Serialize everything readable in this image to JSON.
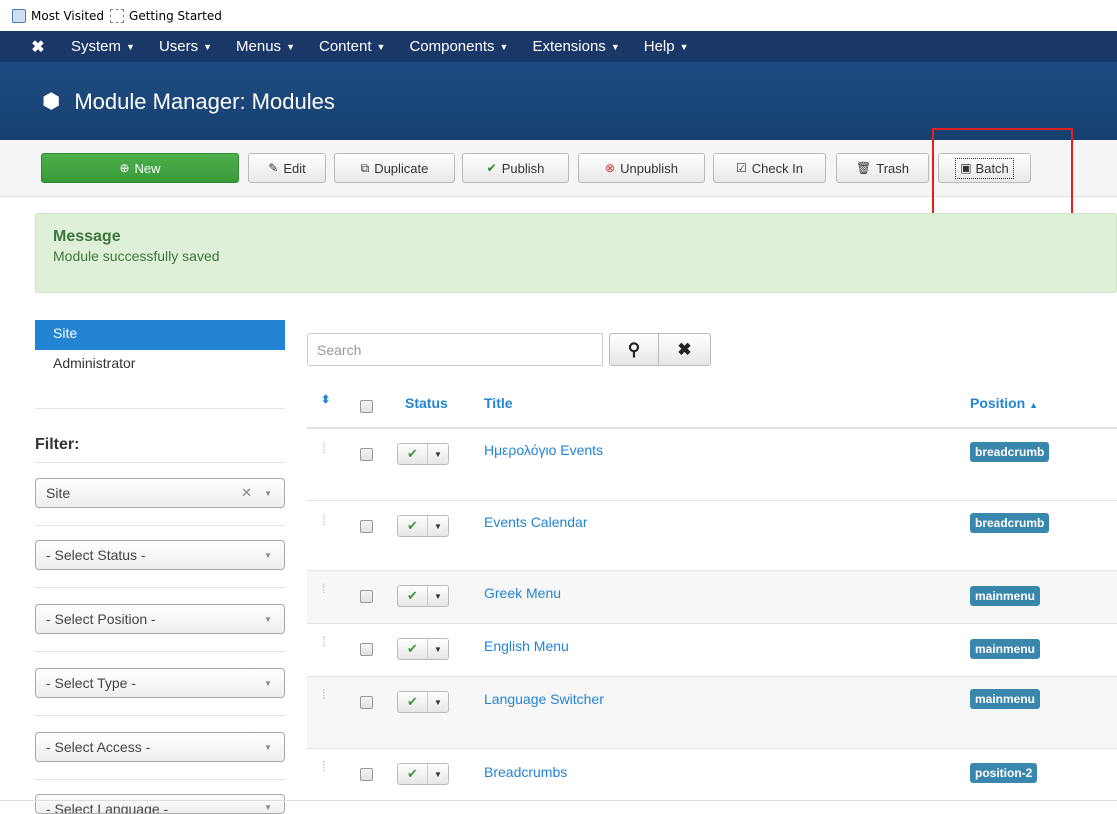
{
  "bookmarks": [
    {
      "label": "Most Visited",
      "icon": "bookmark-folder-icon"
    },
    {
      "label": "Getting Started",
      "icon": "page-icon"
    }
  ],
  "navbar": {
    "logo_icon": "joomla-logo-icon",
    "items": [
      "System",
      "Users",
      "Menus",
      "Content",
      "Components",
      "Extensions",
      "Help"
    ]
  },
  "page": {
    "title": "Module Manager: Modules",
    "title_icon": "cube-icon"
  },
  "toolbar": {
    "new": "New",
    "edit": "Edit",
    "duplicate": "Duplicate",
    "publish": "Publish",
    "unpublish": "Unpublish",
    "checkin": "Check In",
    "trash": "Trash",
    "batch": "Batch"
  },
  "message": {
    "heading": "Message",
    "text": "Module successfully saved"
  },
  "sidebar": {
    "links": [
      "Site",
      "Administrator"
    ],
    "filter_title": "Filter:",
    "filters": [
      "Site",
      "- Select Status -",
      "- Select Position -",
      "- Select Type -",
      "- Select Access -",
      "- Select Language -"
    ]
  },
  "search": {
    "placeholder": "Search"
  },
  "table": {
    "headers": {
      "status": "Status",
      "title": "Title",
      "position": "Position"
    },
    "rows": [
      {
        "title": "Ημερολόγιο Events",
        "position": "breadcrumb"
      },
      {
        "title": "Events Calendar",
        "position": "breadcrumb"
      },
      {
        "title": "Greek Menu",
        "position": "mainmenu"
      },
      {
        "title": "English Menu",
        "position": "mainmenu"
      },
      {
        "title": "Language Switcher",
        "position": "mainmenu"
      },
      {
        "title": "Breadcrumbs",
        "position": "position-2"
      }
    ]
  },
  "colors": {
    "navbar": "#1a3867",
    "titlebar": "#1e4c82",
    "accent": "#2384d3",
    "new_button": "#46a546",
    "badge": "#3a87ad",
    "highlight": "#e32020"
  }
}
